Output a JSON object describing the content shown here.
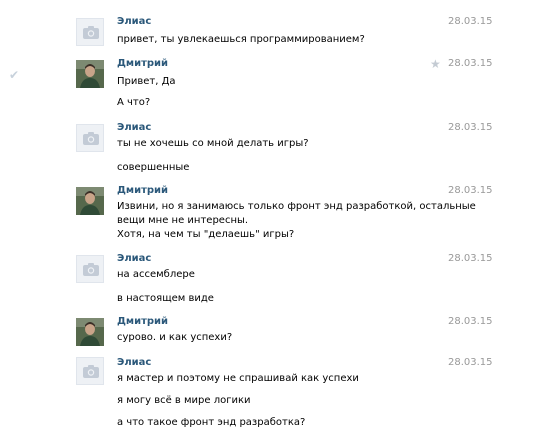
{
  "messages": [
    {
      "author": "Элиас",
      "date": "28.03.15",
      "avatar": "camera-placeholder-icon",
      "lines": [
        "привет, ты увлекаешься программированием?"
      ]
    },
    {
      "author": "Дмитрий",
      "date": "28.03.15",
      "avatar": "user-photo",
      "starred": true,
      "checked": true,
      "lines": [
        "Привет, Да",
        "А что?"
      ]
    },
    {
      "author": "Элиас",
      "date": "28.03.15",
      "avatar": "camera-placeholder-icon",
      "lines": [
        "ты не хочешь со мной делать игры?",
        "совершенные"
      ]
    },
    {
      "author": "Дмитрий",
      "date": "28.03.15",
      "avatar": "user-photo",
      "lines": [
        "Извини, но я занимаюсь только фронт энд разработкой, остальные",
        "вещи мне не интересны.",
        "Хотя, на чем ты \"делаешь\" игры?"
      ]
    },
    {
      "author": "Элиас",
      "date": "28.03.15",
      "avatar": "camera-placeholder-icon",
      "lines": [
        "на ассемблере",
        "в настоящем виде"
      ]
    },
    {
      "author": "Дмитрий",
      "date": "28.03.15",
      "avatar": "user-photo",
      "lines": [
        "сурово. и как успехи?"
      ]
    },
    {
      "author": "Элиас",
      "date": "28.03.15",
      "avatar": "camera-placeholder-icon",
      "lines": [
        "я мастер и поэтому не спрашивай как успехи",
        "я могу всё в мире логики",
        "а что такое фронт энд разработка?"
      ]
    }
  ],
  "icons": {
    "check": "checkmark-icon",
    "star": "star-icon"
  },
  "colors": {
    "author": "#2b587a",
    "date": "#999999"
  }
}
